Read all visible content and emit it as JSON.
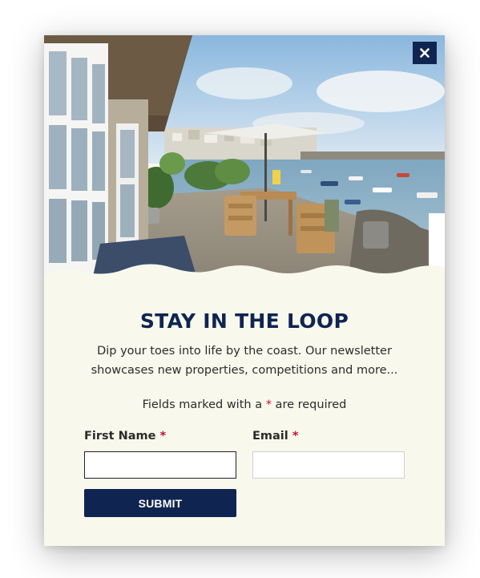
{
  "popup": {
    "title": "STAY IN THE LOOP",
    "description": "Dip your toes into life by the coast. Our newsletter showcases new properties, competitions and more...",
    "required_note_before": "Fields marked with a ",
    "required_marker": "*",
    "required_note_after": " are required",
    "close_icon": "close-icon",
    "hero_image": "coastal-terrace-photo"
  },
  "form": {
    "first_name_label": "First Name",
    "first_name_value": "",
    "email_label": "Email",
    "email_value": "",
    "required_marker": "*",
    "submit_label": "SUBMIT"
  },
  "colors": {
    "navy": "#0f2451",
    "cream": "#f8f8ec",
    "required_red": "#c8102e"
  }
}
